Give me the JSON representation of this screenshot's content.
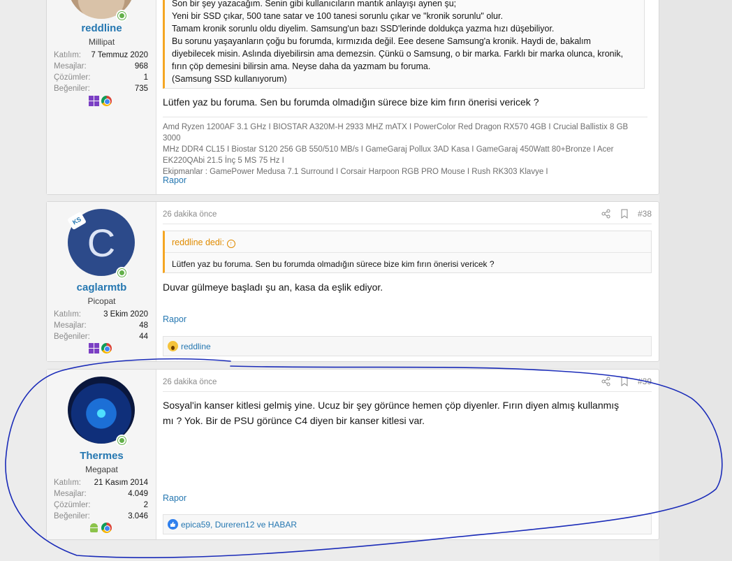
{
  "post1": {
    "user": {
      "name": "reddline",
      "title": "Millipat",
      "stats": [
        {
          "label": "Katılım:",
          "value": "7 Temmuz 2020"
        },
        {
          "label": "Mesajlar:",
          "value": "968"
        },
        {
          "label": "Çözümler:",
          "value": "1"
        },
        {
          "label": "Beğeniler:",
          "value": "735"
        }
      ],
      "badges": [
        "windows-icon",
        "chrome-icon"
      ]
    },
    "quote_lines": [
      "Son bir şey yazacağım. Senin gibi kullanıcıların mantık anlayışı aynen şu;",
      "Yeni bir SSD çıkar, 500 tane satar ve 100 tanesi sorunlu çıkar ve \"kronik sorunlu\" olur.",
      "Tamam kronik sorunlu oldu diyelim. Samsung'un bazı SSD'lerinde doldukça yazma hızı düşebiliyor.",
      "Bu sorunu yaşayanların çoğu bu forumda, kırmızıda değil. Eee desene Samsung'a kronik. Haydi de, bakalım",
      "diyebilecek misin. Aslında diyebilirsin ama demezsin. Çünkü o Samsung, o bir marka. Farklı bir marka olunca, kronik,",
      "fırın çöp demesini bilirsin ama. Neyse daha da yazmam bu foruma.",
      "(Samsung SSD kullanıyorum)"
    ],
    "body": "Lütfen yaz bu foruma. Sen bu forumda olmadığın sürece bize kim fırın önerisi vericek ?",
    "signature_lines": [
      "Amd Ryzen 1200AF 3.1 GHz I BIOSTAR A320M-H 2933 MHZ mATX I PowerColor Red Dragon RX570 4GB I Crucial Ballistix 8 GB 3000",
      "MHz DDR4 CL15 I Biostar S120 256 GB 550/510 MB/s I GameGaraj Pollux 3AD Kasa I GameGaraj 450Watt 80+Bronze I Acer",
      "EK220QAbi 21.5 İnç 5 MS 75 Hz I",
      "Ekipmanlar : GamePower Medusa 7.1 Surround I Corsair Harpoon RGB PRO Mouse I Rush RK303 Klavye I"
    ],
    "report": "Rapor"
  },
  "post2": {
    "user": {
      "name": "caglarmtb",
      "title": "Picopat",
      "avatar_letter": "C",
      "avatar_badge": "KS",
      "stats": [
        {
          "label": "Katılım:",
          "value": "3 Ekim 2020"
        },
        {
          "label": "Mesajlar:",
          "value": "48"
        },
        {
          "label": "Beğeniler:",
          "value": "44"
        }
      ],
      "badges": [
        "windows-icon",
        "chrome-icon"
      ]
    },
    "time": "26 dakika önce",
    "number": "#38",
    "quote_attr": "reddline dedi:",
    "quote_text": "Lütfen yaz bu foruma. Sen bu forumda olmadığın sürece bize kim fırın önerisi vericek ?",
    "body": "Duvar gülmeye başladı şu an, kasa da eşlik ediyor.",
    "report": "Rapor",
    "reactions": "reddline"
  },
  "post3": {
    "user": {
      "name": "Thermes",
      "title": "Megapat",
      "stats": [
        {
          "label": "Katılım:",
          "value": "21 Kasım 2014"
        },
        {
          "label": "Mesajlar:",
          "value": "4.049"
        },
        {
          "label": "Çözümler:",
          "value": "2"
        },
        {
          "label": "Beğeniler:",
          "value": "3.046"
        }
      ],
      "badges": [
        "android-icon",
        "chrome-icon"
      ]
    },
    "time": "26 dakika önce",
    "number": "#39",
    "body_lines": [
      "Sosyal'in kanser kitlesi gelmiş yine. Ucuz bir şey görünce hemen çöp diyenler. Fırın diyen almış kullanmış",
      "mı ? Yok. Bir de PSU görünce C4 diyen bir kanser kitlesi var."
    ],
    "report": "Rapor",
    "reactions": "epica59, Dureren12 ve HABAR"
  },
  "colors": {
    "link": "#2577b1",
    "quote_accent": "#f5a623",
    "online": "#63b04a",
    "annotation": "#1a2bb8"
  }
}
